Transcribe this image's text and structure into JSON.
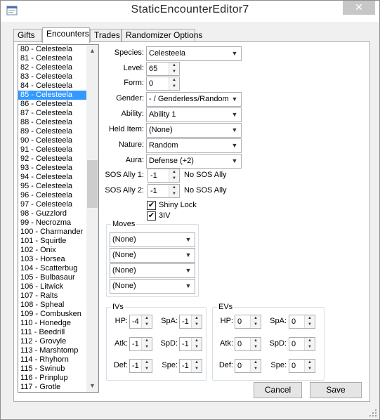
{
  "window": {
    "title": "StaticEncounterEditor7",
    "close_symbol": "✕"
  },
  "tabs": [
    "Gifts",
    "Encounters",
    "Trades",
    "Randomizer Options"
  ],
  "list": {
    "items": [
      "80 - Celesteela",
      "81 - Celesteela",
      "82 - Celesteela",
      "83 - Celesteela",
      "84 - Celesteela",
      "85 - Celesteela",
      "86 - Celesteela",
      "87 - Celesteela",
      "88 - Celesteela",
      "89 - Celesteela",
      "90 - Celesteela",
      "91 - Celesteela",
      "92 - Celesteela",
      "93 - Celesteela",
      "94 - Celesteela",
      "95 - Celesteela",
      "96 - Celesteela",
      "97 - Celesteela",
      "98 - Guzzlord",
      "99 - Necrozma",
      "100 - Charmander",
      "101 - Squirtle",
      "102 - Onix",
      "103 - Horsea",
      "104 - Scatterbug",
      "105 - Bulbasaur",
      "106 - Litwick",
      "107 - Ralts",
      "108 - Spheal",
      "109 - Combusken",
      "110 - Honedge",
      "111 - Beedrill",
      "112 - Grovyle",
      "113 - Marshtomp",
      "114 - Rhyhorn",
      "115 - Swinub",
      "116 - Prinplup",
      "117 - Grotle"
    ],
    "selected": "85 - Celesteela"
  },
  "fields": {
    "species": {
      "label": "Species:",
      "value": "Celesteela"
    },
    "level": {
      "label": "Level:",
      "value": "65"
    },
    "form": {
      "label": "Form:",
      "value": "0"
    },
    "gender": {
      "label": "Gender:",
      "value": "- / Genderless/Random"
    },
    "ability": {
      "label": "Ability:",
      "value": "Ability 1"
    },
    "held_item": {
      "label": "Held Item:",
      "value": "(None)"
    },
    "nature": {
      "label": "Nature:",
      "value": "Random"
    },
    "aura": {
      "label": "Aura:",
      "value": "Defense (+2)"
    },
    "sos1": {
      "label": "SOS Ally 1:",
      "value": "-1",
      "desc": "No SOS Ally"
    },
    "sos2": {
      "label": "SOS Ally 2:",
      "value": "-1",
      "desc": "No SOS Ally"
    }
  },
  "checks": {
    "shiny_lock": {
      "label": "Shiny Lock",
      "checked": true
    },
    "three_iv": {
      "label": "3IV",
      "checked": true
    }
  },
  "moves": {
    "title": "Moves",
    "values": [
      "(None)",
      "(None)",
      "(None)",
      "(None)"
    ]
  },
  "ivs": {
    "title": "IVs",
    "hp": {
      "label": "HP:",
      "value": "-4"
    },
    "atk": {
      "label": "Atk:",
      "value": "-1"
    },
    "def": {
      "label": "Def:",
      "value": "-1"
    },
    "spa": {
      "label": "SpA:",
      "value": "-1"
    },
    "spd": {
      "label": "SpD:",
      "value": "-1"
    },
    "spe": {
      "label": "Spe:",
      "value": "-1"
    }
  },
  "evs": {
    "title": "EVs",
    "hp": {
      "label": "HP:",
      "value": "0"
    },
    "atk": {
      "label": "Atk:",
      "value": "0"
    },
    "def": {
      "label": "Def:",
      "value": "0"
    },
    "spa": {
      "label": "SpA:",
      "value": "0"
    },
    "spd": {
      "label": "SpD:",
      "value": "0"
    },
    "spe": {
      "label": "Spe:",
      "value": "0"
    }
  },
  "buttons": {
    "cancel": "Cancel",
    "save": "Save"
  },
  "icons": {
    "dropdown": "chevron-down-icon",
    "spin_up": "▲",
    "spin_down": "▼",
    "check": "✔",
    "scroll_up": "▲",
    "scroll_down": "▼"
  }
}
